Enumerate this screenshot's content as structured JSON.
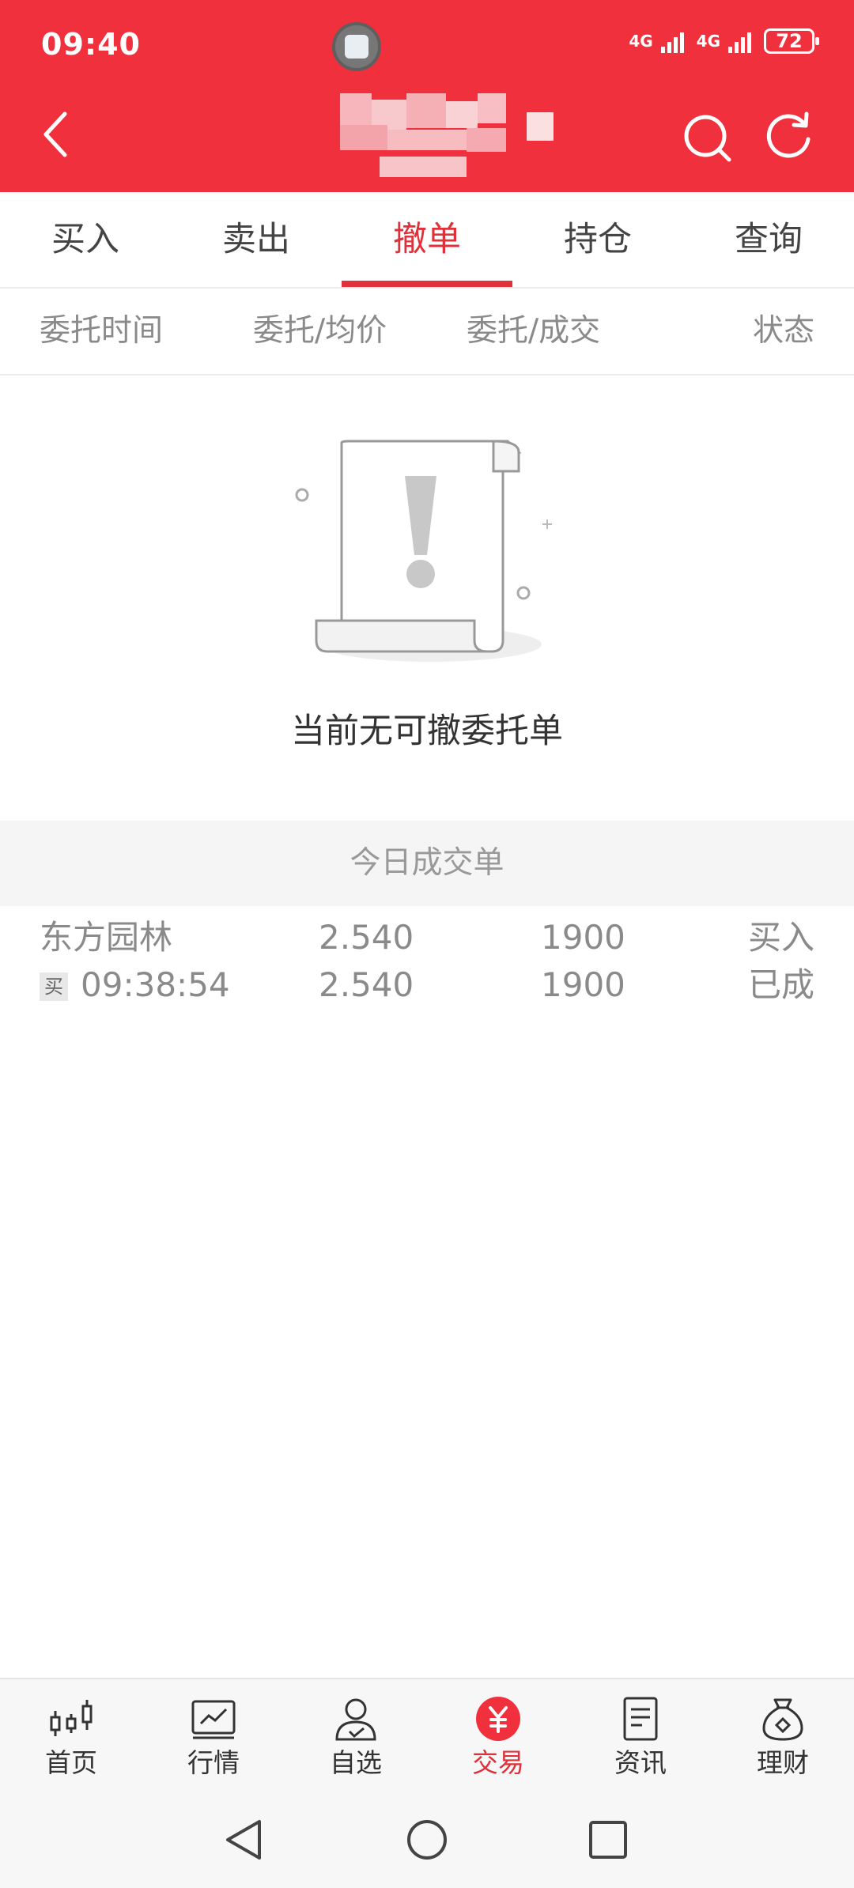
{
  "status_bar": {
    "time": "09:40",
    "network1": "4G",
    "network2": "4G",
    "battery": "72"
  },
  "header": {
    "title": ""
  },
  "tabs": [
    {
      "label": "买入"
    },
    {
      "label": "卖出"
    },
    {
      "label": "撤单"
    },
    {
      "label": "持仓"
    },
    {
      "label": "查询"
    }
  ],
  "columns": {
    "col1": "委托时间",
    "col2": "委托/均价",
    "col3": "委托/成交",
    "col4": "状态"
  },
  "empty_state": {
    "message": "当前无可撤委托单"
  },
  "today_section": {
    "title": "今日成交单"
  },
  "trades": [
    {
      "name": "东方园林",
      "price": "2.540",
      "qty": "1900",
      "direction": "买入",
      "tag": "买",
      "time": "09:38:54",
      "avg_price": "2.540",
      "filled": "1900",
      "status": "已成"
    }
  ],
  "bottom_nav": [
    {
      "label": "首页",
      "icon": "candlestick-icon"
    },
    {
      "label": "行情",
      "icon": "market-chart-icon"
    },
    {
      "label": "自选",
      "icon": "user-watchlist-icon"
    },
    {
      "label": "交易",
      "icon": "yuan-trade-icon"
    },
    {
      "label": "资讯",
      "icon": "news-document-icon"
    },
    {
      "label": "理财",
      "icon": "money-bag-icon"
    }
  ],
  "colors": {
    "accent": "#f0303c",
    "active_tab": "#e0303a",
    "muted": "#8a8a8a"
  }
}
